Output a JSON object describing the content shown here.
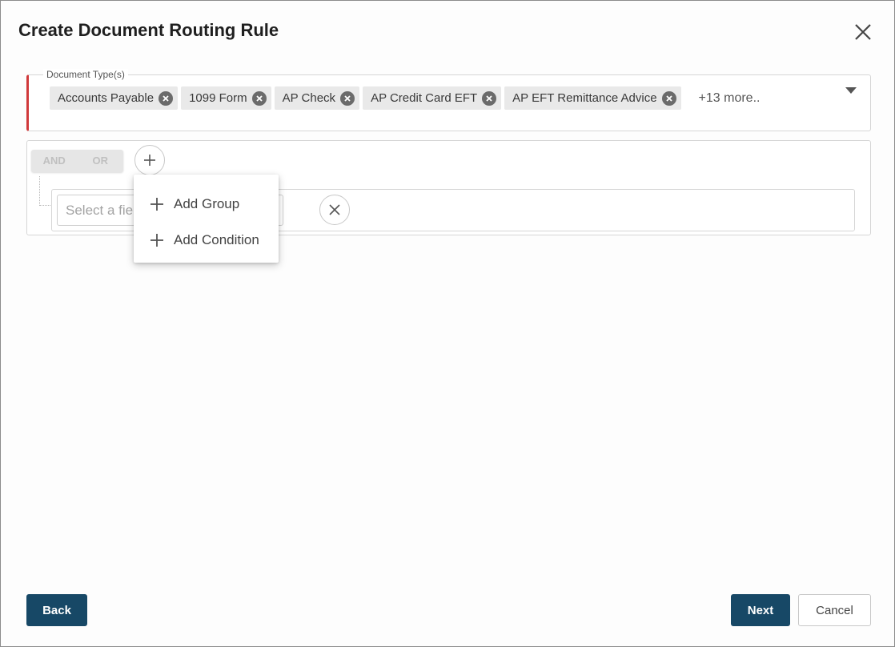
{
  "dialog": {
    "title": "Create Document Routing Rule",
    "close_icon": "close-icon"
  },
  "document_types": {
    "legend": "Document Type(s)",
    "chips": [
      {
        "label": "Accounts Payable"
      },
      {
        "label": "1099 Form"
      },
      {
        "label": "AP Check"
      },
      {
        "label": "AP Credit Card EFT"
      },
      {
        "label": "AP EFT Remittance Advice"
      }
    ],
    "more_label": "+13 more..",
    "accent_color": "#d0393b"
  },
  "query": {
    "and_label": "AND",
    "or_label": "OR",
    "field_placeholder": "Select a field"
  },
  "menu": {
    "items": [
      {
        "label": "Add Group",
        "icon": "plus-icon"
      },
      {
        "label": "Add Condition",
        "icon": "plus-icon"
      }
    ]
  },
  "footer": {
    "back_label": "Back",
    "next_label": "Next",
    "cancel_label": "Cancel",
    "primary_color": "#174866"
  }
}
